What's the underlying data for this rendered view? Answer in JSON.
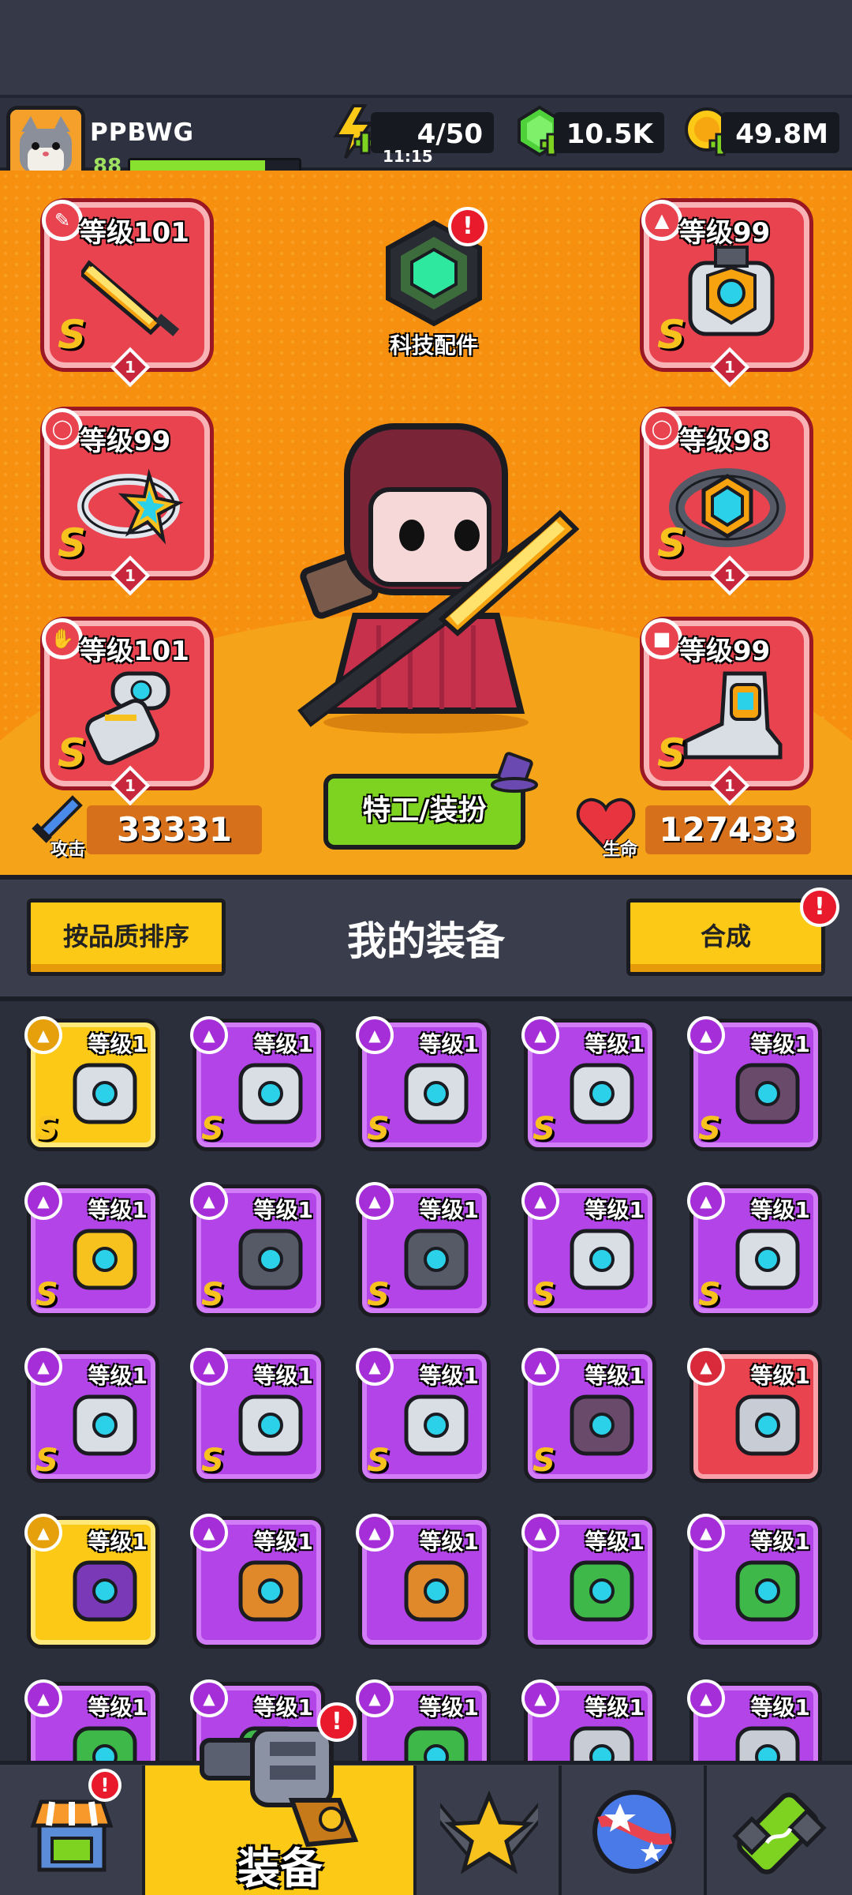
{
  "player": {
    "name": "PPBWG",
    "level": "88",
    "xp_fraction": 0.8
  },
  "resources": {
    "energy": {
      "value": "4/50",
      "timer": "11:15",
      "icon": "lightning-icon"
    },
    "gems": {
      "value": "10.5K",
      "icon": "green-gem-icon"
    },
    "coins": {
      "value": "49.8M",
      "icon": "gold-coin-icon"
    }
  },
  "tech": {
    "label": "科技配件",
    "icon": "tech-hexagon-icon",
    "alert": "!"
  },
  "equipped": [
    {
      "slot": "weapon",
      "icon": "sword-icon",
      "badge": "gun-icon",
      "level": "等级101",
      "grade": "S",
      "rank": "1"
    },
    {
      "slot": "ring",
      "icon": "star-ring-icon",
      "badge": "ring-icon",
      "level": "等级99",
      "grade": "S",
      "rank": "1"
    },
    {
      "slot": "gloves",
      "icon": "gauntlet-icon",
      "badge": "hand-icon",
      "level": "等级101",
      "grade": "S",
      "rank": "1"
    },
    {
      "slot": "armor",
      "icon": "armor-icon",
      "badge": "shirt-icon",
      "level": "等级99",
      "grade": "S",
      "rank": "1"
    },
    {
      "slot": "belt",
      "icon": "belt-icon",
      "badge": "belt-badge-icon",
      "level": "等级98",
      "grade": "S",
      "rank": "1"
    },
    {
      "slot": "boots",
      "icon": "boot-icon",
      "badge": "boot-badge-icon",
      "level": "等级99",
      "grade": "S",
      "rank": "1"
    }
  ],
  "stats": {
    "attack_label": "攻击",
    "attack": "33331",
    "hp_label": "生命",
    "hp": "127433"
  },
  "agent_button": "特工/装扮",
  "equipment": {
    "sort_button": "按品质排序",
    "title": "我的装备",
    "merge_button": "合成",
    "merge_alert": "!",
    "items": [
      {
        "quality": "gold",
        "icon": "blaster-icon",
        "level": "等级1",
        "grade": "S"
      },
      {
        "quality": "purple",
        "icon": "armor-icon",
        "level": "等级1",
        "grade": "S"
      },
      {
        "quality": "purple",
        "icon": "armor-icon",
        "level": "等级1",
        "grade": "S"
      },
      {
        "quality": "purple",
        "icon": "armor-icon",
        "level": "等级1",
        "grade": "S"
      },
      {
        "quality": "purple",
        "icon": "dark-armor-icon",
        "level": "等级1",
        "grade": "S"
      },
      {
        "quality": "purple",
        "icon": "star-ring-icon",
        "level": "等级1",
        "grade": "S"
      },
      {
        "quality": "purple",
        "icon": "belt-icon",
        "level": "等级1",
        "grade": "S"
      },
      {
        "quality": "purple",
        "icon": "belt-icon",
        "level": "等级1",
        "grade": "S"
      },
      {
        "quality": "purple",
        "icon": "gauntlet-icon",
        "level": "等级1",
        "grade": "S"
      },
      {
        "quality": "purple",
        "icon": "gauntlet-icon",
        "level": "等级1",
        "grade": "S"
      },
      {
        "quality": "purple",
        "icon": "gauntlet-icon",
        "level": "等级1",
        "grade": "S"
      },
      {
        "quality": "purple",
        "icon": "gauntlet-icon",
        "level": "等级1",
        "grade": "S"
      },
      {
        "quality": "purple",
        "icon": "gauntlet-icon",
        "level": "等级1",
        "grade": "S"
      },
      {
        "quality": "purple",
        "icon": "dark-gauntlet-icon",
        "level": "等级1",
        "grade": "S"
      },
      {
        "quality": "red",
        "icon": "kunai-icon",
        "level": "等级1",
        "grade": ""
      },
      {
        "quality": "gold",
        "icon": "purple-gauntlet-icon",
        "level": "等级1",
        "grade": ""
      },
      {
        "quality": "purple",
        "icon": "microphone-icon",
        "level": "等级1",
        "grade": ""
      },
      {
        "quality": "purple",
        "icon": "microphone-icon",
        "level": "等级1",
        "grade": ""
      },
      {
        "quality": "purple",
        "icon": "leaf-armor-icon",
        "level": "等级1",
        "grade": ""
      },
      {
        "quality": "purple",
        "icon": "leaf-armor-icon",
        "level": "等级1",
        "grade": ""
      },
      {
        "quality": "purple",
        "icon": "leaf-armor-icon",
        "level": "等级1",
        "grade": ""
      },
      {
        "quality": "purple",
        "icon": "leaf-armor-icon",
        "level": "等级1",
        "grade": ""
      },
      {
        "quality": "purple",
        "icon": "leaf-armor-icon",
        "level": "等级1",
        "grade": ""
      },
      {
        "quality": "purple",
        "icon": "steel-armor-icon",
        "level": "等级1",
        "grade": ""
      },
      {
        "quality": "purple",
        "icon": "steel-armor-icon",
        "level": "等级1",
        "grade": ""
      }
    ]
  },
  "nav": {
    "shop": {
      "icon": "shop-icon",
      "alert": "!"
    },
    "equipment": {
      "icon": "revolver-icon",
      "label": "装备",
      "alert": "!"
    },
    "battle": {
      "icon": "crossed-swords-star-icon"
    },
    "planet": {
      "icon": "planet-icon"
    },
    "gene": {
      "icon": "dna-capsule-icon"
    }
  },
  "colors": {
    "hero_bg": "#f7900f",
    "slot_red": "#e8434f",
    "purple": "#b344e8",
    "gold": "#fbc916",
    "accent_green": "#7ed321"
  }
}
